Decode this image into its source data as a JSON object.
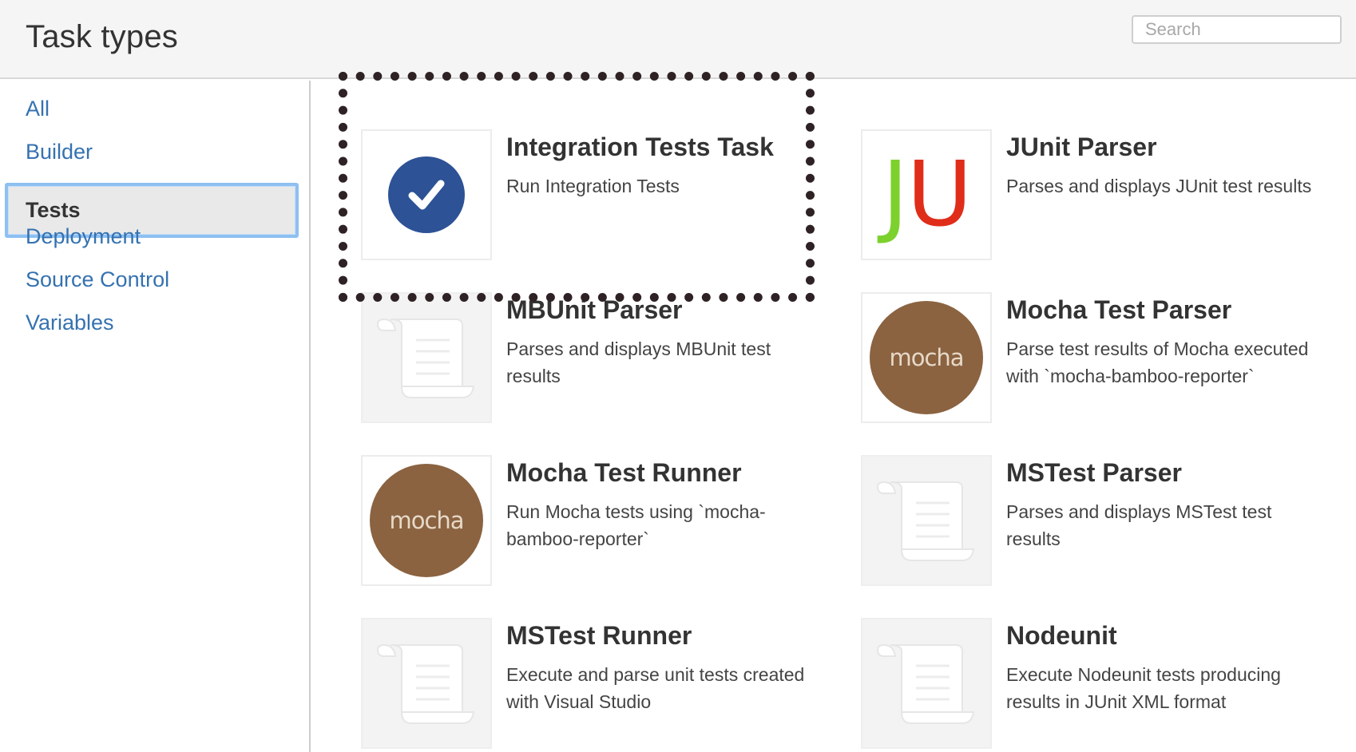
{
  "header": {
    "title": "Task types",
    "search_placeholder": "Search"
  },
  "sidebar": {
    "items": [
      {
        "label": "All",
        "selected": false
      },
      {
        "label": "Builder",
        "selected": false
      },
      {
        "label": "Tests",
        "selected": true
      },
      {
        "label": "Deployment",
        "selected": false
      },
      {
        "label": "Source Control",
        "selected": false
      },
      {
        "label": "Variables",
        "selected": false
      }
    ]
  },
  "tasks": [
    {
      "name": "Integration Tests Task",
      "description": "Run Integration Tests",
      "icon": "checkmark-circle-icon"
    },
    {
      "name": "JUnit Parser",
      "description": "Parses and displays JUnit test results",
      "icon": "junit-logo-icon",
      "icon_text": "JU"
    },
    {
      "name": "MBUnit Parser",
      "description": "Parses and displays MBUnit test results",
      "icon": "document-scroll-icon"
    },
    {
      "name": "Mocha Test Parser",
      "description": "Parse test results of Mocha executed with `mocha-bamboo-reporter`",
      "icon": "mocha-logo-icon",
      "icon_text": "mocha"
    },
    {
      "name": "Mocha Test Runner",
      "description": "Run Mocha tests using `mocha-bamboo-reporter`",
      "icon": "mocha-logo-icon",
      "icon_text": "mocha"
    },
    {
      "name": "MSTest Parser",
      "description": "Parses and displays MSTest test results",
      "icon": "document-scroll-icon"
    },
    {
      "name": "MSTest Runner",
      "description": "Execute and parse unit tests created with Visual Studio",
      "icon": "document-scroll-icon"
    },
    {
      "name": "Nodeunit",
      "description": "Execute Nodeunit tests producing results in JUnit XML format",
      "icon": "document-scroll-icon"
    }
  ],
  "colors": {
    "link": "#3572b0",
    "selection_border": "#8ec0f1",
    "highlight_dots": "#2e2224",
    "mocha_brown": "#8b6341",
    "check_blue": "#2d5295",
    "junit_green": "#7cd12d",
    "junit_red": "#df2d1a"
  }
}
